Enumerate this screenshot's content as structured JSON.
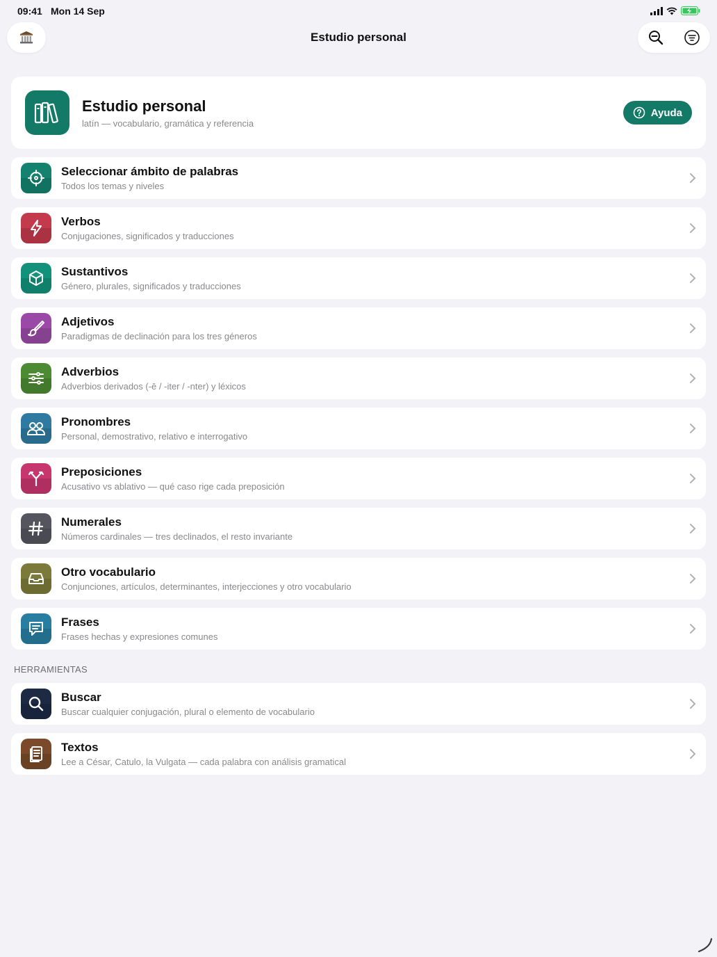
{
  "status_bar": {
    "time": "09:41",
    "date": "Mon 14 Sep"
  },
  "nav": {
    "title": "Estudio personal"
  },
  "header": {
    "title": "Estudio personal",
    "subtitle": "latín — vocabulario, gramática y referencia",
    "help_label": "Ayuda",
    "accent": "#137a68"
  },
  "rows": [
    {
      "title": "Seleccionar ámbito de palabras",
      "subtitle": "Todos los temas y niveles",
      "icon": "crosshair-icon",
      "color": "#14826f"
    },
    {
      "title": "Verbos",
      "subtitle": "Conjugaciones, significados y traducciones",
      "icon": "bolt-icon",
      "color": "#c33a4c"
    },
    {
      "title": "Sustantivos",
      "subtitle": "Género, plurales, significados y traducciones",
      "icon": "cube-icon",
      "color": "#13917a"
    },
    {
      "title": "Adjetivos",
      "subtitle": "Paradigmas de declinación para los tres géneros",
      "icon": "brush-icon",
      "color": "#9a4aa6"
    },
    {
      "title": "Adverbios",
      "subtitle": "Adverbios derivados (-ē / -iter / -nter) y léxicos",
      "icon": "sliders-icon",
      "color": "#4c8a34"
    },
    {
      "title": "Pronombres",
      "subtitle": "Personal, demostrativo, relativo e interrogativo",
      "icon": "people-icon",
      "color": "#2e7aa0"
    },
    {
      "title": "Preposiciones",
      "subtitle": "Acusativo vs ablativo — qué caso rige cada preposición",
      "icon": "fork-icon",
      "color": "#c8366e"
    },
    {
      "title": "Numerales",
      "subtitle": "Números cardinales — tres declinados, el resto invariante",
      "icon": "hash-icon",
      "color": "#55555f"
    },
    {
      "title": "Otro vocabulario",
      "subtitle": "Conjunciones, artículos, determinantes, interjecciones y otro vocabulario",
      "icon": "inbox-icon",
      "color": "#7b7a3a"
    },
    {
      "title": "Frases",
      "subtitle": "Frases hechas y expresiones comunes",
      "icon": "chat-icon",
      "color": "#277ea0"
    }
  ],
  "tools_section": {
    "label": "HERRAMIENTAS"
  },
  "tools": [
    {
      "title": "Buscar",
      "subtitle": "Buscar cualquier conjugación, plural o elemento de vocabulario",
      "icon": "search-icon",
      "color": "#1c2a44"
    },
    {
      "title": "Textos",
      "subtitle": "Lee a César, Catulo, la Vulgata — cada palabra con análisis gramatical",
      "icon": "document-icon",
      "color": "#7a4a2a"
    }
  ]
}
